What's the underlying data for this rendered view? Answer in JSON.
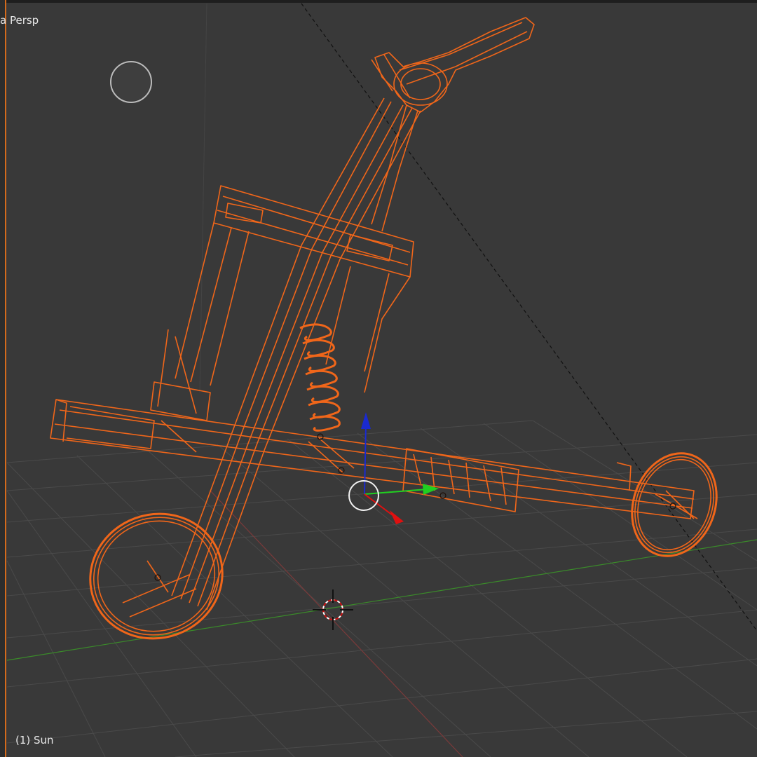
{
  "viewport": {
    "view_label": "a Persp",
    "object_label": "(1) Sun"
  },
  "colors": {
    "background": "#393939",
    "grid": "#4a4a4a",
    "x_axis": "#7a3a3a",
    "y_axis": "#3a8a2a",
    "selected_wire": "#f0661a",
    "gizmo_x": "#e01010",
    "gizmo_y": "#20d020",
    "gizmo_z": "#1a2ad0"
  },
  "scene": {
    "selected_object": "golf-trolley-wireframe",
    "shading": "wireframe"
  }
}
